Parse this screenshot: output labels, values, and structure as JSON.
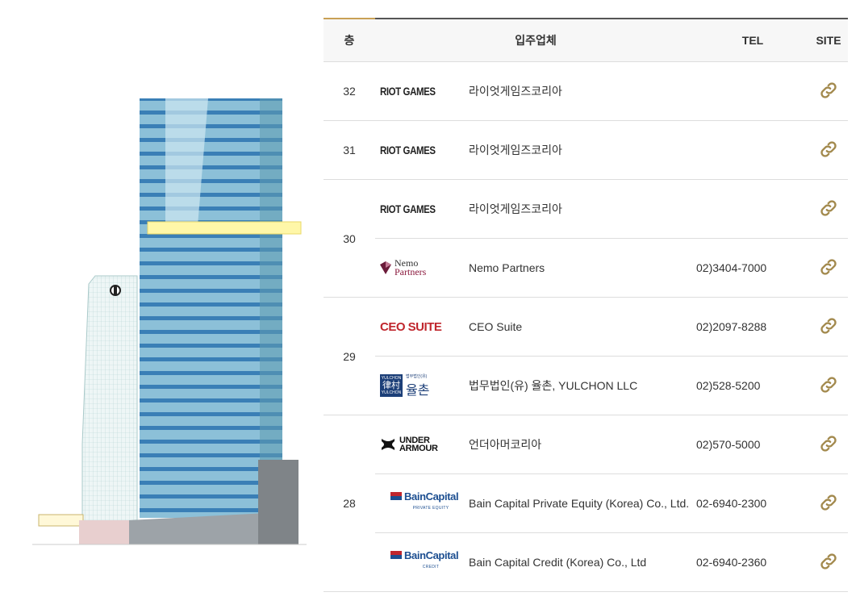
{
  "header": {
    "floor": "층",
    "tenant": "입주업체",
    "tel": "TEL",
    "site": "SITE"
  },
  "colors": {
    "accent": "#c9a055",
    "link_icon": "#a38a4e",
    "header_bg": "#f7f7f7"
  },
  "rows": [
    {
      "floor": "32",
      "logo": "RIOT GAMES",
      "name": "라이엇게임즈코리아",
      "tel": ""
    },
    {
      "floor": "31",
      "logo": "RIOT GAMES",
      "name": "라이엇게임즈코리아",
      "tel": ""
    },
    {
      "floor": "30",
      "logo": "RIOT GAMES",
      "name": "라이엇게임즈코리아",
      "tel": ""
    },
    {
      "floor": "",
      "logo": "Nemo Partners",
      "name": "Nemo Partners",
      "tel": "02)3404-7000"
    },
    {
      "floor": "29",
      "logo": "CEO SUITE",
      "name": "CEO Suite",
      "tel": "02)2097-8288"
    },
    {
      "floor": "",
      "logo": "율촌",
      "name": "법무법인(유) 율촌, YULCHON LLC",
      "tel": "02)528-5200"
    },
    {
      "floor": "28",
      "logo": "UNDER ARMOUR",
      "name": "언더아머코리아",
      "tel": "02)570-5000"
    },
    {
      "floor": "",
      "logo": "BainCapital",
      "name": "Bain Capital Private Equity (Korea) Co., Ltd.",
      "tel": "02-6940-2300"
    },
    {
      "floor": "",
      "logo": "BainCapital",
      "name": "Bain Capital Credit (Korea) Co., Ltd",
      "tel": "02-6940-2360"
    }
  ],
  "logos": {
    "riot": "RIOT GAMES",
    "ceo": "CEO SUITE",
    "ua_1": "UNDER",
    "ua_2": "ARMOUR",
    "bain": "BainCapital",
    "bain_pe": "PRIVATE EQUITY",
    "bain_credit": "CREDIT",
    "nemo_1": "Nemo",
    "nemo_2": "Partners",
    "yul_box_1": "YULCHON",
    "yul_box_han": "律村",
    "yul_box_2": "YULCHON",
    "yul_small": "법무법인(유)",
    "yul_big": "율촌"
  },
  "building": {
    "highlight_floor": "30"
  }
}
